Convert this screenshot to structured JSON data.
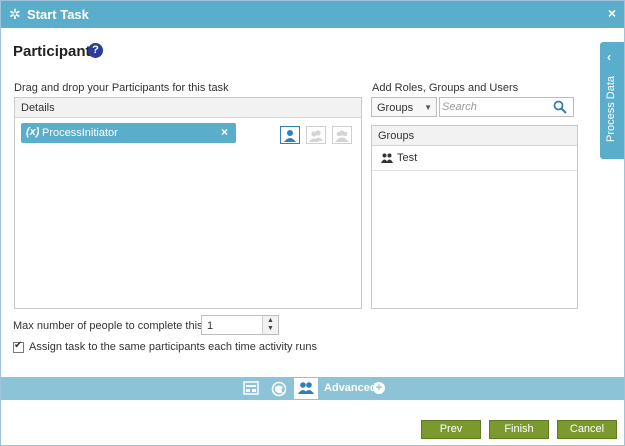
{
  "window": {
    "title": "Start Task",
    "close_glyph": "×",
    "gear_glyph": "✲"
  },
  "heading": {
    "title": "Participants",
    "help_glyph": "?"
  },
  "side_tab": {
    "label": "Process Data",
    "chevron": "‹"
  },
  "participants": {
    "drag_label": "Drag and drop your Participants for this task",
    "header": "Details",
    "chips": [
      {
        "prefix": "(x)",
        "name": "ProcessInitiator",
        "remove_glyph": "×"
      }
    ],
    "types": [
      "single-user-icon",
      "multiple-users-icon",
      "group-users-icon"
    ]
  },
  "add": {
    "label": "Add Roles, Groups and Users",
    "select_value": "Groups",
    "search_placeholder": "Search",
    "list_header": "Groups",
    "items": [
      {
        "name": "Test",
        "icon": "group-icon"
      }
    ]
  },
  "settings": {
    "max_label": "Max number of people to complete this task:",
    "max_value": "1",
    "assign_label": "Assign task to the same participants each time activity runs",
    "assign_checked": true
  },
  "tabs": {
    "advanced_label": "Advanced",
    "advanced_plus": "+"
  },
  "buttons": {
    "prev": "Prev",
    "finish": "Finish",
    "cancel": "Cancel"
  },
  "colors": {
    "titlebar": "#5aaecb",
    "tabbar": "#8dc3d7",
    "button": "#7a9a2e",
    "help": "#2b3c9b"
  }
}
